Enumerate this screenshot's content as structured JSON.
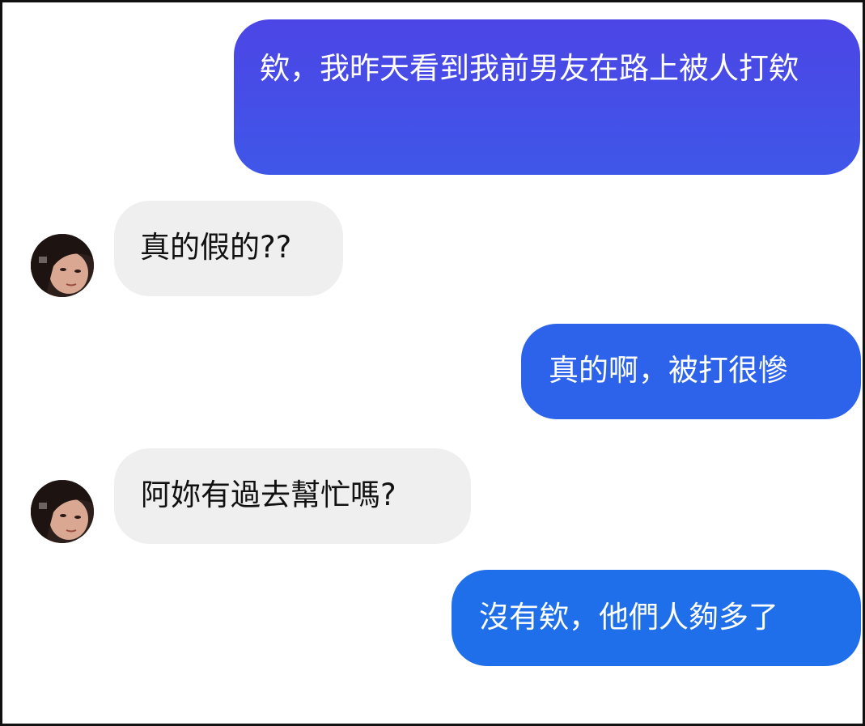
{
  "messages": [
    {
      "side": "sent",
      "text": "欸，我昨天看到我前男友在路上被人打欸"
    },
    {
      "side": "received",
      "text": "真的假的??"
    },
    {
      "side": "sent",
      "text": "真的啊，被打很慘"
    },
    {
      "side": "received",
      "text": "阿妳有過去幫忙嗎?"
    },
    {
      "side": "sent",
      "text": "沒有欸，他們人夠多了"
    }
  ],
  "colors": {
    "sent_bubble_top": "#4c45e6",
    "sent_bubble_mid": "#2c63ea",
    "sent_bubble_bottom": "#1f6fea",
    "received_bubble": "#efefef"
  },
  "icons": {
    "contact_avatar": "profile-photo-icon"
  }
}
